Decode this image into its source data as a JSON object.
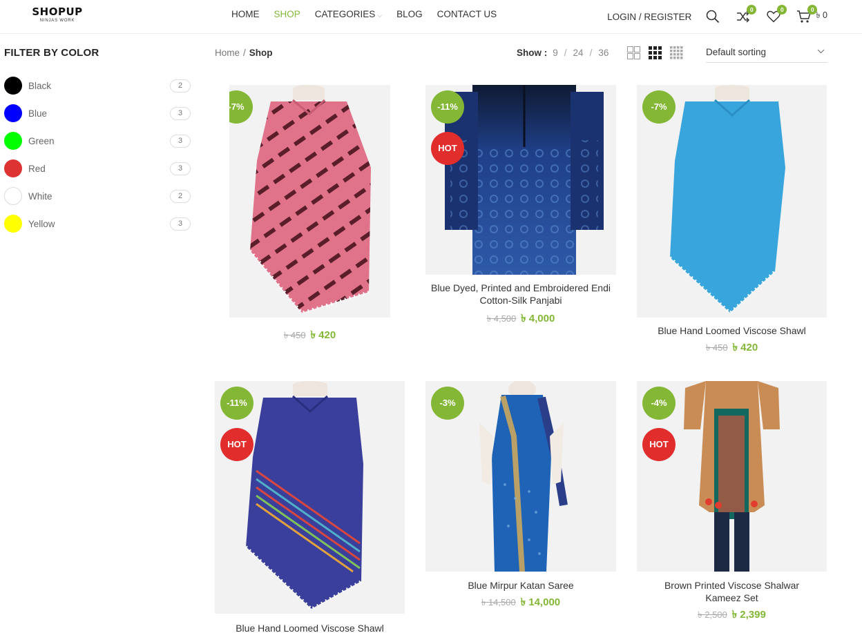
{
  "logo": {
    "main": "SHOPUP",
    "tagline": "NINJAS WORK"
  },
  "nav": {
    "items": [
      {
        "label": "HOME",
        "active": false
      },
      {
        "label": "SHOP",
        "active": true
      },
      {
        "label": "CATEGORIES",
        "active": false
      },
      {
        "label": "BLOG",
        "active": false
      },
      {
        "label": "CONTACT US",
        "active": false
      }
    ],
    "categories_caret": "⌵"
  },
  "header": {
    "login_label": "LOGIN / REGISTER",
    "compare_count": "0",
    "wishlist_count": "0",
    "cart_count": "0",
    "cart_total": "৳ 0"
  },
  "sidebar": {
    "title": "FILTER BY COLOR",
    "colors": [
      {
        "label": "Black",
        "count": "2",
        "hex": "#000000"
      },
      {
        "label": "Blue",
        "count": "3",
        "hex": "#0000ff"
      },
      {
        "label": "Green",
        "count": "3",
        "hex": "#00ff00"
      },
      {
        "label": "Red",
        "count": "3",
        "hex": "#dd3333"
      },
      {
        "label": "White",
        "count": "2",
        "hex": "#ffffff"
      },
      {
        "label": "Yellow",
        "count": "3",
        "hex": "#ffff00"
      }
    ]
  },
  "toolbar": {
    "breadcrumb": {
      "home": "Home",
      "separator": "/",
      "current": "Shop"
    },
    "show_label": "Show :",
    "show_options": [
      "9",
      "24",
      "36"
    ],
    "show_separator": "/",
    "sorting_label": "Default sorting"
  },
  "colors": {
    "accent": "#83b735",
    "hot": "#e22d2d"
  },
  "products": [
    {
      "name": "",
      "old_price": "৳ 450",
      "new_price": "৳ 420",
      "badges": [
        "-7%"
      ],
      "image": "pink-ikat-shawl"
    },
    {
      "name": "Blue Dyed, Printed and Embroidered Endi Cotton-Silk Panjabi",
      "old_price": "৳ 4,500",
      "new_price": "৳ 4,000",
      "badges": [
        "-11%",
        "HOT"
      ],
      "image": "blue-panjabi"
    },
    {
      "name": "Blue Hand Loomed Viscose Shawl",
      "old_price": "৳ 450",
      "new_price": "৳ 420",
      "badges": [
        "-7%"
      ],
      "image": "sky-blue-shawl"
    },
    {
      "name": "Blue Hand Loomed Viscose Shawl",
      "old_price": "",
      "new_price": "",
      "badges": [
        "-11%",
        "HOT"
      ],
      "image": "navy-striped-shawl"
    },
    {
      "name": "Blue Mirpur Katan Saree",
      "old_price": "৳ 14,500",
      "new_price": "৳ 14,000",
      "badges": [
        "-3%"
      ],
      "image": "blue-saree"
    },
    {
      "name": "Brown Printed Viscose Shalwar Kameez Set",
      "old_price": "৳ 2,500",
      "new_price": "৳ 2,399",
      "badges": [
        "-4%",
        "HOT"
      ],
      "image": "brown-shalwar-kameez"
    }
  ]
}
